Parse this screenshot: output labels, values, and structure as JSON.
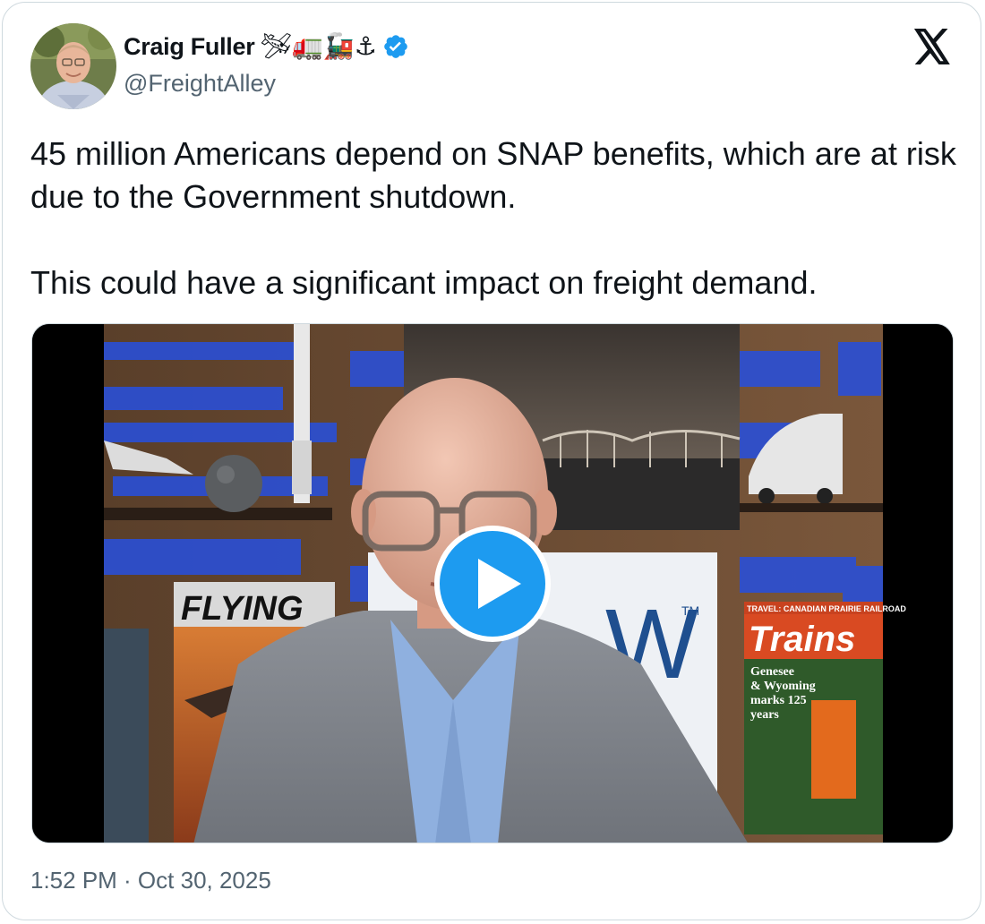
{
  "author": {
    "display_name": "Craig Fuller",
    "emoji": "🛩🚛🚂⚓",
    "handle": "@FreightAlley",
    "verified": true
  },
  "tweet": {
    "line1": "45 million Americans depend on SNAP benefits, which are at risk due to the Government shutdown.",
    "line2": "This could have a significant impact on freight demand."
  },
  "media": {
    "type": "video",
    "poster_text": {
      "magazine_left": "FLYING",
      "magazine_right_top": "TRAVEL: CANADIAN PRAIRIE RAILROAD",
      "magazine_right_title": "Trains",
      "magazine_right_sub1": "Genesee",
      "magazine_right_sub2": "& Wyoming",
      "magazine_right_sub3": "marks 125",
      "magazine_right_sub4": "years",
      "sign_text": "W",
      "sign_tm": "TM"
    }
  },
  "timestamp": "1:52 PM · Oct 30, 2025",
  "colors": {
    "accent": "#1d9bf0",
    "text": "#0f1419",
    "secondary": "#536471",
    "border": "#cfd9de"
  },
  "icons": [
    "verified-badge-icon",
    "x-logo-icon",
    "play-icon"
  ]
}
